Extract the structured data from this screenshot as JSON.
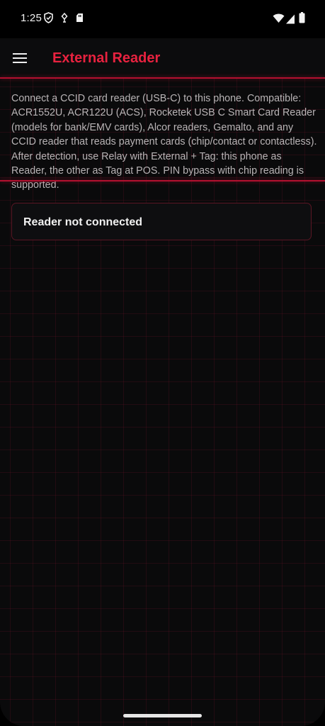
{
  "status_bar": {
    "time": "1:25",
    "left_icons": [
      "shield-icon",
      "usb-debug-icon",
      "sd-card-icon"
    ],
    "right_icons": [
      "wifi-icon",
      "cell-signal-icon",
      "battery-icon"
    ]
  },
  "app_bar": {
    "title": "External Reader",
    "menu_icon": "hamburger-menu-icon"
  },
  "colors": {
    "accent": "#e8223f",
    "accent_line": "#b3102f",
    "background": "#0a0a0b",
    "text_secondary": "#b9b4b6"
  },
  "content": {
    "description": "Connect a CCID card reader (USB-C) to this phone. Compatible: ACR1552U, ACR122U (ACS), Rocketek USB C Smart Card Reader (models for bank/EMV cards), Alcor readers, Gemalto, and any CCID reader that reads payment cards (chip/contact or contactless). After detection, use Relay with External + Tag: this phone as Reader, the other as Tag at POS. PIN bypass with chip reading is supported.",
    "reader_status": "Reader not connected"
  }
}
